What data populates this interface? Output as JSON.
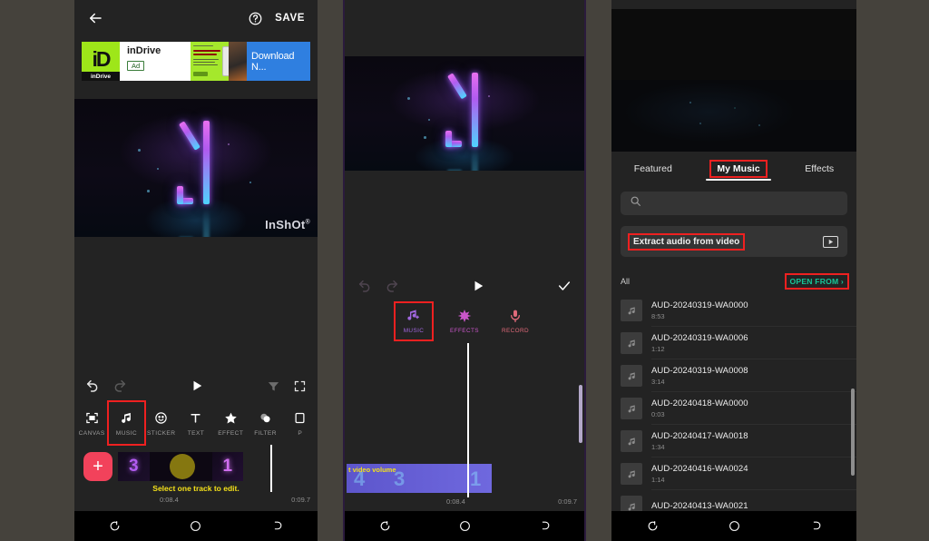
{
  "panel1": {
    "topbar": {
      "back_icon": "arrow-left-icon",
      "help_icon": "help-circle-icon",
      "save_label": "SAVE"
    },
    "ad": {
      "logo_glyph": "iD",
      "logo_name": "inDrive",
      "title": "inDrive",
      "badge": "Ad",
      "cta": "Download N..."
    },
    "preview": {
      "watermark": "InShOt",
      "watermark_sup": "®"
    },
    "controls": {
      "undo_icon": "undo-icon",
      "redo_icon": "redo-icon",
      "play_icon": "play-icon",
      "filter_icon": "filter-add-icon",
      "fullscreen_icon": "fullscreen-icon"
    },
    "tools": [
      {
        "label": "CANVAS",
        "icon": "canvas-icon",
        "highlighted": false
      },
      {
        "label": "MUSIC",
        "icon": "music-note-icon",
        "highlighted": true
      },
      {
        "label": "STICKER",
        "icon": "sticker-smiley-icon",
        "highlighted": false
      },
      {
        "label": "TEXT",
        "icon": "text-t-icon",
        "highlighted": false
      },
      {
        "label": "EFFECT",
        "icon": "star-icon",
        "highlighted": false
      },
      {
        "label": "FILTER",
        "icon": "filter-drop-icon",
        "highlighted": false
      },
      {
        "label": "P",
        "icon": "partial-icon",
        "highlighted": false
      }
    ],
    "timeline": {
      "add_label": "+",
      "hint": "Select one track to edit.",
      "current_time": "0:08.4",
      "total_time": "0:09.7",
      "frames": [
        "3",
        "",
        "1"
      ]
    }
  },
  "panel2": {
    "controls": {
      "undo_icon": "undo-icon",
      "redo_icon": "redo-icon",
      "play_icon": "play-icon",
      "confirm_icon": "check-icon"
    },
    "tools": [
      {
        "label": "MUSIC",
        "icon": "music-add-icon",
        "highlighted": true,
        "color": "#a267e0"
      },
      {
        "label": "EFFECTS",
        "icon": "effects-burst-icon",
        "highlighted": false,
        "color": "#c956c9"
      },
      {
        "label": "RECORD",
        "icon": "microphone-icon",
        "highlighted": false,
        "color": "#e06a7a"
      }
    ],
    "clip": {
      "label": "t video volume",
      "digits": [
        "4",
        "3",
        "1"
      ]
    },
    "timeline": {
      "current_time": "0:08.4",
      "total_time": "0:09.7"
    }
  },
  "panel3": {
    "tabs": [
      {
        "label": "Featured",
        "active": false,
        "highlighted": false
      },
      {
        "label": "My Music",
        "active": true,
        "highlighted": true
      },
      {
        "label": "Effects",
        "active": false,
        "highlighted": false
      }
    ],
    "search": {
      "placeholder": "",
      "value": "",
      "icon": "search-icon"
    },
    "extract": {
      "label": "Extract audio from video",
      "play_icon": "play-box-icon",
      "highlighted": true
    },
    "all_label": "All",
    "open_from": {
      "label": "OPEN FROM ›",
      "highlighted": true
    },
    "tracks": [
      {
        "name": "AUD-20240319-WA0000",
        "duration": "8:53",
        "icon": "music-note-icon"
      },
      {
        "name": "AUD-20240319-WA0006",
        "duration": "1:12",
        "icon": "music-note-icon"
      },
      {
        "name": "AUD-20240319-WA0008",
        "duration": "3:14",
        "icon": "music-note-icon"
      },
      {
        "name": "AUD-20240418-WA0000",
        "duration": "0:03",
        "icon": "music-note-icon"
      },
      {
        "name": "AUD-20240417-WA0018",
        "duration": "1:34",
        "icon": "music-note-icon"
      },
      {
        "name": "AUD-20240416-WA0024",
        "duration": "1:14",
        "icon": "music-note-icon"
      },
      {
        "name": "AUD-20240413-WA0021",
        "duration": "",
        "icon": "music-note-icon"
      }
    ]
  },
  "navbar": {
    "recents_icon": "recents-icon",
    "home_icon": "home-circle-icon",
    "back_icon": "back-arc-icon"
  },
  "colors": {
    "background": "#45423c",
    "panel_bg": "#232323",
    "highlight": "#ef2020",
    "accent_green": "#16c79a",
    "hint_yellow": "#f5e11a",
    "add_button": "#f2425b",
    "clip_purple": "#6a63d6"
  }
}
